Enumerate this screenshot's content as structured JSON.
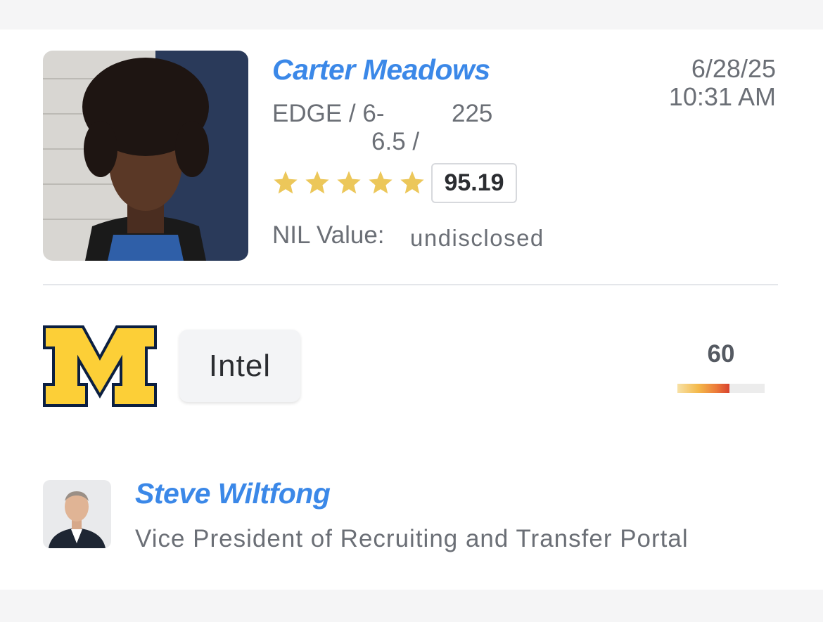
{
  "prediction": {
    "player": {
      "name": "Carter Meadows",
      "position": "EDGE",
      "height_part1": "6-",
      "height_part2": "6.5 /",
      "weight": "225",
      "stars": 5,
      "rating": "95.19",
      "nil_label": "NIL Value:",
      "nil_value": "undisclosed"
    },
    "date": "6/28/25",
    "time": "10:31 AM",
    "school_logo_icon": "michigan-block-m-logo",
    "intel_label": "Intel",
    "confidence": {
      "value": "60",
      "fraction": 0.6
    },
    "author": {
      "name": "Steve Wiltfong",
      "title": "Vice President of Recruiting and Transfer Portal"
    }
  },
  "colors": {
    "link_blue": "#3b88e8",
    "star_gold": "#ecc75a",
    "michigan_maize": "#fccf37",
    "michigan_blue": "#0b1f41"
  }
}
